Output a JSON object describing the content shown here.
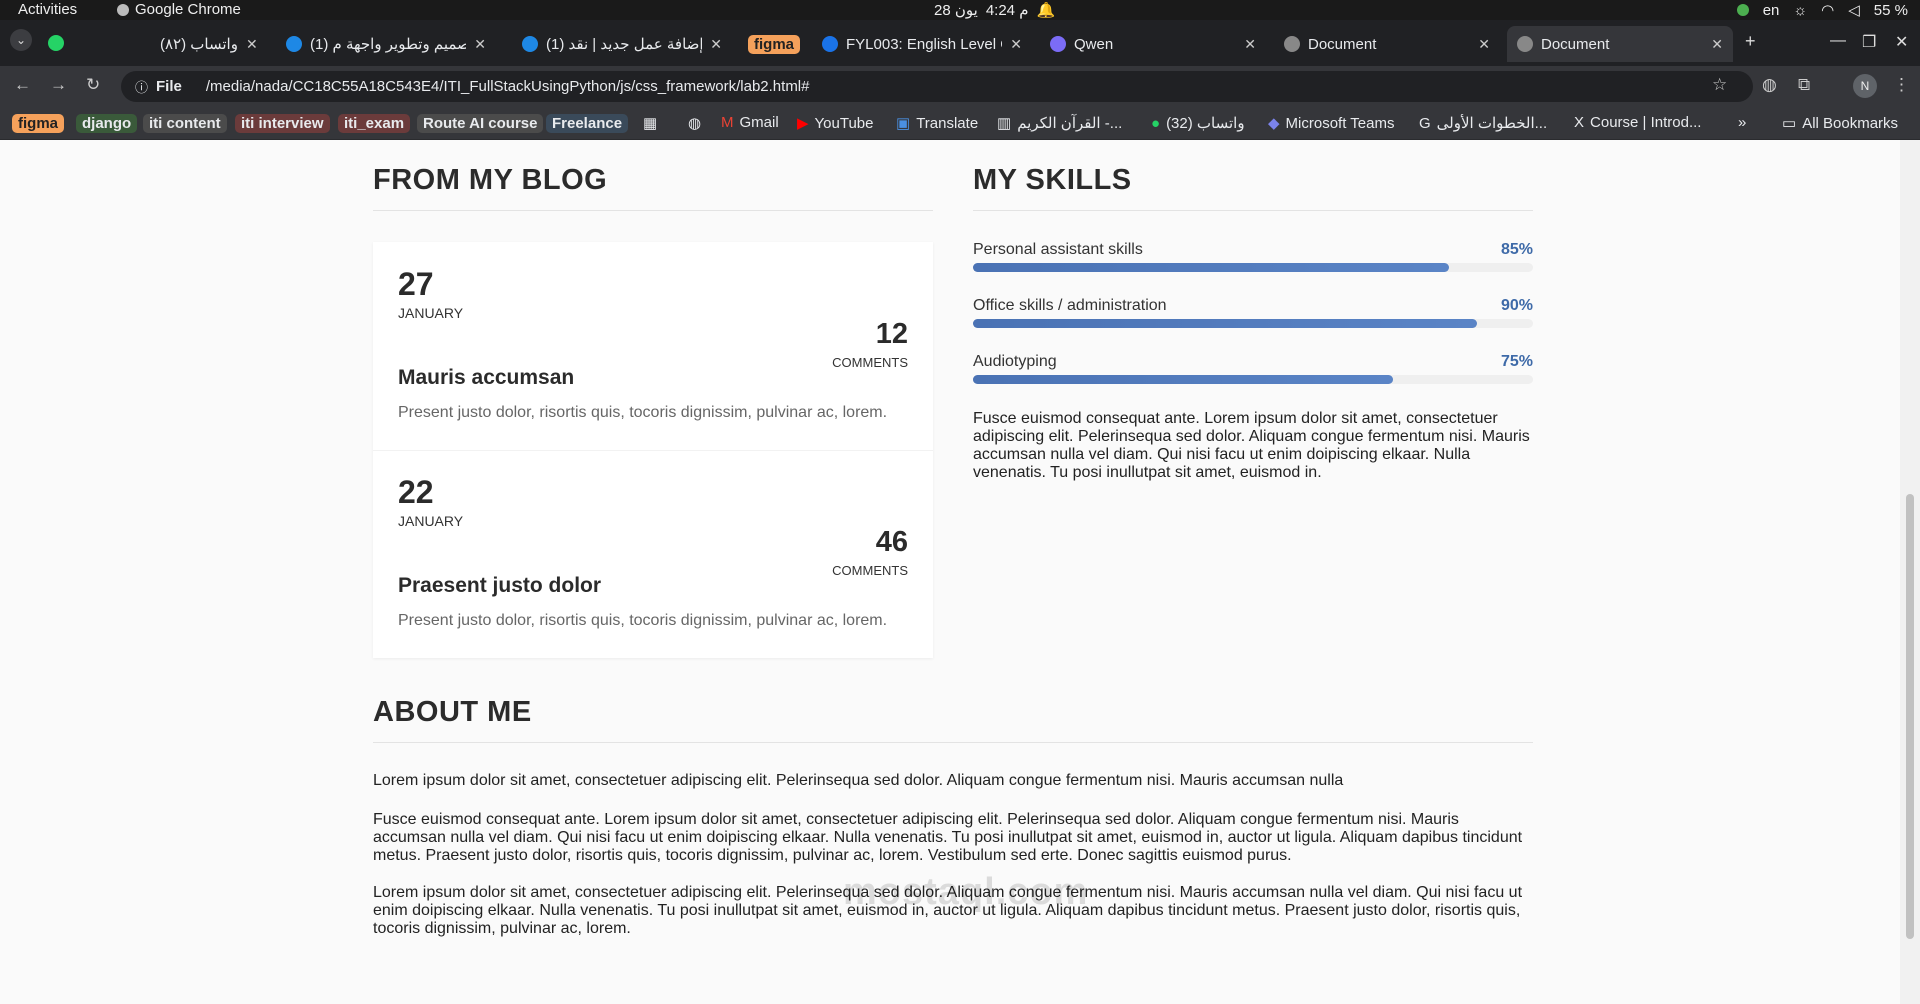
{
  "os": {
    "activities": "Activities",
    "app": "Google Chrome",
    "date": "28 يون",
    "time": "4:24 م",
    "lang": "en",
    "battery": "55 %"
  },
  "tabs": [
    {
      "title": "(٨٢) واتساب"
    },
    {
      "title": "(1) تصميم وتطوير واجهة م..."
    },
    {
      "title": "(1) إضافة عمل جديد | نقد..."
    },
    {
      "title": "figma"
    },
    {
      "title": "FYL003: English Level G..."
    },
    {
      "title": "Qwen"
    },
    {
      "title": "Document"
    },
    {
      "title": "Document"
    }
  ],
  "address": {
    "scheme": "File",
    "url": "/media/nada/CC18C55A18C543E4/ITI_FullStackUsingPython/js/css_framework/lab2.html#",
    "avatar": "N"
  },
  "bookmarks": [
    "figma",
    "django",
    "iti content",
    "iti interview",
    "iti_exam",
    "Route AI course",
    "Freelance",
    "Gmail",
    "YouTube",
    "Translate",
    "القرآن الكريم -...",
    "(32) واتساب",
    "Microsoft Teams",
    "الخطوات الأولى...",
    "Course | Introd...",
    "All Bookmarks"
  ],
  "blog": {
    "heading": "FROM MY BLOG",
    "posts": [
      {
        "day": "27",
        "month": "JANUARY",
        "comments": "12",
        "comments_label": "COMMENTS",
        "title": "Mauris accumsan",
        "excerpt": "Present justo dolor, risortis quis, tocoris dignissim, pulvinar ac, lorem."
      },
      {
        "day": "22",
        "month": "JANUARY",
        "comments": "46",
        "comments_label": "COMMENTS",
        "title": "Praesent justo dolor",
        "excerpt": "Present justo dolor, risortis quis, tocoris dignissim, pulvinar ac, lorem."
      }
    ]
  },
  "skills": {
    "heading": "MY SKILLS",
    "items": [
      {
        "label": "Personal assistant skills",
        "percent": "85%",
        "value": 85
      },
      {
        "label": "Office skills / administration",
        "percent": "90%",
        "value": 90
      },
      {
        "label": "Audiotyping",
        "percent": "75%",
        "value": 75
      }
    ],
    "text": "Fusce euismod consequat ante. Lorem ipsum dolor sit amet, consectetuer adipiscing elit. Pelerinsequa sed dolor. Aliquam congue fermentum nisi. Mauris accumsan nulla vel diam. Qui nisi facu ut enim doipiscing elkaar. Nulla venenatis. Tu posi inullutpat sit amet, euismod in."
  },
  "about": {
    "heading": "ABOUT ME",
    "p1": "Lorem ipsum dolor sit amet, consectetuer adipiscing elit. Pelerinsequa sed dolor. Aliquam congue fermentum nisi. Mauris accumsan nulla",
    "p2": "Fusce euismod consequat ante. Lorem ipsum dolor sit amet, consectetuer adipiscing elit. Pelerinsequa sed dolor. Aliquam congue fermentum nisi. Mauris accumsan nulla vel diam. Qui nisi facu ut enim doipiscing elkaar. Nulla venenatis. Tu posi inullutpat sit amet, euismod in, auctor ut ligula. Aliquam dapibus tincidunt metus. Praesent justo dolor, risortis quis, tocoris dignissim, pulvinar ac, lorem. Vestibulum sed erte. Donec sagittis euismod purus.",
    "p3": "Lorem ipsum dolor sit amet, consectetuer adipiscing elit. Pelerinsequa sed dolor. Aliquam congue fermentum nisi. Mauris accumsan nulla vel diam. Qui nisi facu ut enim doipiscing elkaar. Nulla venenatis. Tu posi inullutpat sit amet, euismod in, auctor ut ligula. Aliquam dapibus tincidunt metus. Praesent justo dolor, risortis quis, tocoris dignissim, pulvinar ac, lorem."
  },
  "watermark": "mostaql.com"
}
